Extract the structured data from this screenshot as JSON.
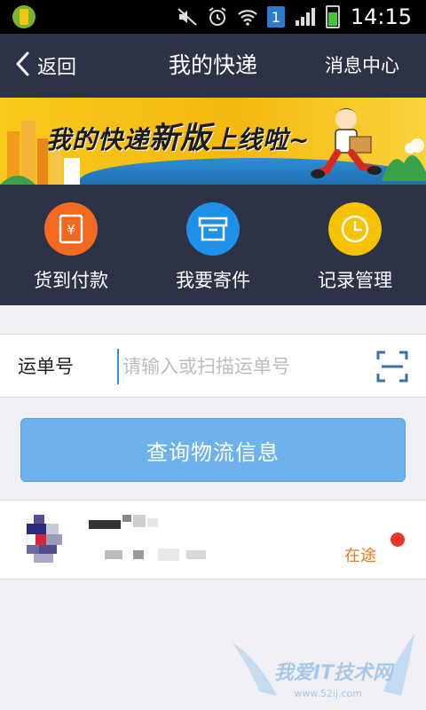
{
  "status_bar": {
    "time": "14:15",
    "sim_label": "1",
    "icons": [
      "app-badge-icon",
      "mute-icon",
      "alarm-icon",
      "wifi-icon",
      "sim-icon",
      "signal-icon",
      "battery-icon"
    ]
  },
  "nav": {
    "back_label": "返回",
    "title": "我的快递",
    "right_label": "消息中心"
  },
  "banner": {
    "text_part1": "我的快递",
    "text_part2": "新版",
    "text_part3": "上线啦~"
  },
  "quick_actions": [
    {
      "label": "货到付款",
      "icon": "yuan-receipt-icon",
      "color": "#f2691f"
    },
    {
      "label": "我要寄件",
      "icon": "box-icon",
      "color": "#1e90e8"
    },
    {
      "label": "记录管理",
      "icon": "clock-icon",
      "color": "#f5c300"
    }
  ],
  "tracking": {
    "label": "运单号",
    "placeholder": "请输入或扫描运单号",
    "value": ""
  },
  "query_button": {
    "label": "查询物流信息"
  },
  "package": {
    "status": "在途"
  },
  "watermark": {
    "text": "我爱IT技术网",
    "sub": "www.52ij.com"
  },
  "colors": {
    "nav_bg": "#2e3246",
    "accent_blue": "#6eb2ec",
    "status_orange": "#ee7a1c",
    "dot_red": "#e8352c"
  }
}
